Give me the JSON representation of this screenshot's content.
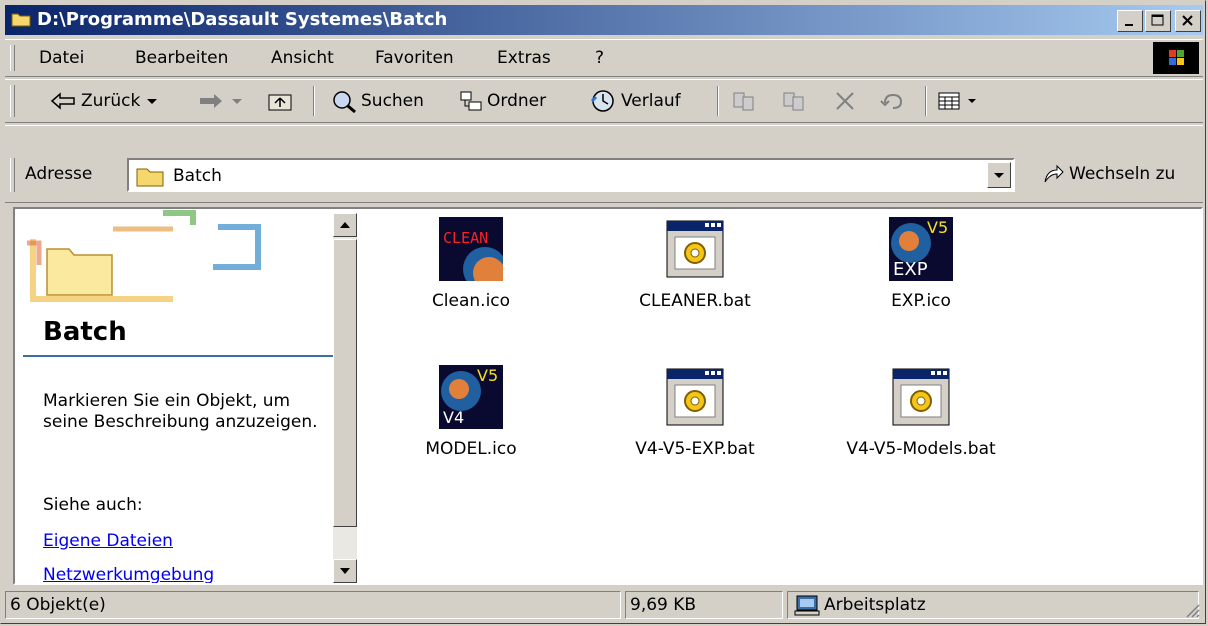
{
  "window": {
    "title": "D:\\Programme\\Dassault Systemes\\Batch"
  },
  "menu": {
    "items": [
      "Datei",
      "Bearbeiten",
      "Ansicht",
      "Favoriten",
      "Extras",
      "?"
    ]
  },
  "toolbar": {
    "back_label": "Zurück",
    "search_label": "Suchen",
    "folders_label": "Ordner",
    "history_label": "Verlauf"
  },
  "address": {
    "label": "Adresse",
    "value": "Batch",
    "go_label": "Wechseln zu"
  },
  "panel": {
    "title": "Batch",
    "description": "Markieren Sie ein Objekt, um seine Beschreibung anzuzeigen.",
    "see_also": "Siehe auch:",
    "links": [
      "Eigene Dateien",
      "Netzwerkumgebung"
    ]
  },
  "files": [
    {
      "name": "Clean.ico",
      "icon": "clean-icon"
    },
    {
      "name": "CLEANER.bat",
      "icon": "batch-file-icon"
    },
    {
      "name": "EXP.ico",
      "icon": "exp-icon"
    },
    {
      "name": "MODEL.ico",
      "icon": "model-icon"
    },
    {
      "name": "V4-V5-EXP.bat",
      "icon": "batch-file-icon"
    },
    {
      "name": "V4-V5-Models.bat",
      "icon": "batch-file-icon"
    }
  ],
  "status": {
    "count": "6 Objekt(e)",
    "size": "9,69 KB",
    "zone": "Arbeitsplatz"
  }
}
